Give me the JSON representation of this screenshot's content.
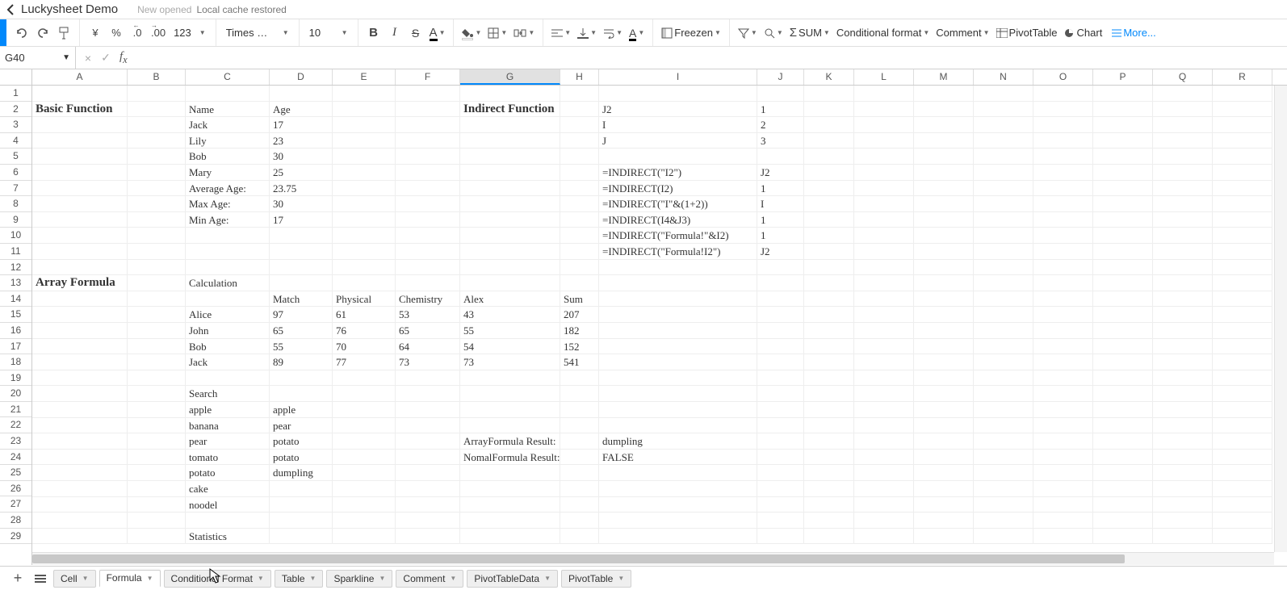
{
  "header": {
    "title": "Luckysheet Demo",
    "msg1": "New opened",
    "msg2": "Local cache restored"
  },
  "toolbar": {
    "currency": "¥",
    "percent": "%",
    "dec_dec": ".0",
    "inc_dec": ".00",
    "more_fmt": "123",
    "font_name": "Times …",
    "font_size": "10",
    "bold": "B",
    "italic": "I",
    "strike": "S",
    "font_color": "A",
    "freeze": "Freezen",
    "autosum": "SUM",
    "cond_format": "Conditional format",
    "comment": "Comment",
    "pivot": "PivotTable",
    "chart": "Chart",
    "more": "More..."
  },
  "formula_bar": {
    "name_box": "G40",
    "cancel": "×",
    "confirm": "✓",
    "fx": "fx",
    "input": ""
  },
  "columns": [
    "A",
    "B",
    "C",
    "D",
    "E",
    "F",
    "G",
    "H",
    "I",
    "J",
    "K",
    "L",
    "M",
    "N",
    "O",
    "P",
    "Q",
    "R"
  ],
  "col_widths": {
    "A": 118,
    "B": 72,
    "C": 104,
    "D": 78,
    "E": 78,
    "F": 80,
    "G": 124,
    "H": 48,
    "I": 196,
    "J": 58,
    "K": 62,
    "L": 74,
    "M": 74,
    "N": 74,
    "O": 74,
    "P": 74,
    "Q": 74,
    "R": 74
  },
  "selected_column": "G",
  "row_count": 29,
  "cells": {
    "A2": {
      "v": "Basic Function",
      "bold": true
    },
    "C2": {
      "v": "Name"
    },
    "D2": {
      "v": "Age"
    },
    "G2": {
      "v": "Indirect Function",
      "bold": true
    },
    "I2": {
      "v": "J2"
    },
    "J2": {
      "v": "1"
    },
    "C3": {
      "v": "Jack"
    },
    "D3": {
      "v": "17"
    },
    "I3": {
      "v": "I"
    },
    "J3": {
      "v": "2"
    },
    "C4": {
      "v": "Lily"
    },
    "D4": {
      "v": "23"
    },
    "I4": {
      "v": "J"
    },
    "J4": {
      "v": "3"
    },
    "C5": {
      "v": "Bob"
    },
    "D5": {
      "v": "30"
    },
    "C6": {
      "v": "Mary"
    },
    "D6": {
      "v": "25"
    },
    "I6": {
      "v": "=INDIRECT(\"I2\")"
    },
    "J6": {
      "v": "J2"
    },
    "C7": {
      "v": "Average Age:"
    },
    "D7": {
      "v": "23.75"
    },
    "I7": {
      "v": "=INDIRECT(I2)"
    },
    "J7": {
      "v": "1"
    },
    "C8": {
      "v": "Max Age:"
    },
    "D8": {
      "v": "30"
    },
    "I8": {
      "v": "=INDIRECT(\"I\"&(1+2))"
    },
    "J8": {
      "v": "I"
    },
    "C9": {
      "v": "Min Age:"
    },
    "D9": {
      "v": "17"
    },
    "I9": {
      "v": "=INDIRECT(I4&J3)"
    },
    "J9": {
      "v": "1"
    },
    "I10": {
      "v": "=INDIRECT(\"Formula!\"&I2)"
    },
    "J10": {
      "v": "1"
    },
    "I11": {
      "v": "=INDIRECT(\"Formula!I2\")"
    },
    "J11": {
      "v": "J2"
    },
    "A13": {
      "v": "Array Formula",
      "bold": true
    },
    "C13": {
      "v": "Calculation"
    },
    "D14": {
      "v": "Match"
    },
    "E14": {
      "v": "Physical"
    },
    "F14": {
      "v": "Chemistry"
    },
    "G14": {
      "v": "Alex"
    },
    "H14": {
      "v": "Sum"
    },
    "C15": {
      "v": "Alice"
    },
    "D15": {
      "v": "97"
    },
    "E15": {
      "v": "61"
    },
    "F15": {
      "v": "53"
    },
    "G15": {
      "v": "43"
    },
    "H15": {
      "v": "207"
    },
    "C16": {
      "v": "John"
    },
    "D16": {
      "v": "65"
    },
    "E16": {
      "v": "76"
    },
    "F16": {
      "v": "65"
    },
    "G16": {
      "v": "55"
    },
    "H16": {
      "v": "182"
    },
    "C17": {
      "v": "Bob"
    },
    "D17": {
      "v": "55"
    },
    "E17": {
      "v": "70"
    },
    "F17": {
      "v": "64"
    },
    "G17": {
      "v": "54"
    },
    "H17": {
      "v": "152"
    },
    "C18": {
      "v": "Jack"
    },
    "D18": {
      "v": "89"
    },
    "E18": {
      "v": "77"
    },
    "F18": {
      "v": "73"
    },
    "G18": {
      "v": "73"
    },
    "H18": {
      "v": "541"
    },
    "C20": {
      "v": "Search"
    },
    "C21": {
      "v": "apple"
    },
    "D21": {
      "v": "apple"
    },
    "C22": {
      "v": "banana"
    },
    "D22": {
      "v": "pear"
    },
    "C23": {
      "v": "pear"
    },
    "D23": {
      "v": "potato"
    },
    "G23": {
      "v": "ArrayFormula Result:"
    },
    "I23": {
      "v": "dumpling"
    },
    "C24": {
      "v": "tomato"
    },
    "D24": {
      "v": "potato"
    },
    "G24": {
      "v": "NomalFormula Result:"
    },
    "I24": {
      "v": "FALSE"
    },
    "C25": {
      "v": "potato"
    },
    "D25": {
      "v": "dumpling"
    },
    "C26": {
      "v": "cake"
    },
    "C27": {
      "v": "noodel"
    },
    "C29": {
      "v": "Statistics"
    }
  },
  "sheets": [
    "Cell",
    "Formula",
    "Conditional Format",
    "Table",
    "Sparkline",
    "Comment",
    "PivotTableData",
    "PivotTable"
  ],
  "active_sheet": "Formula"
}
